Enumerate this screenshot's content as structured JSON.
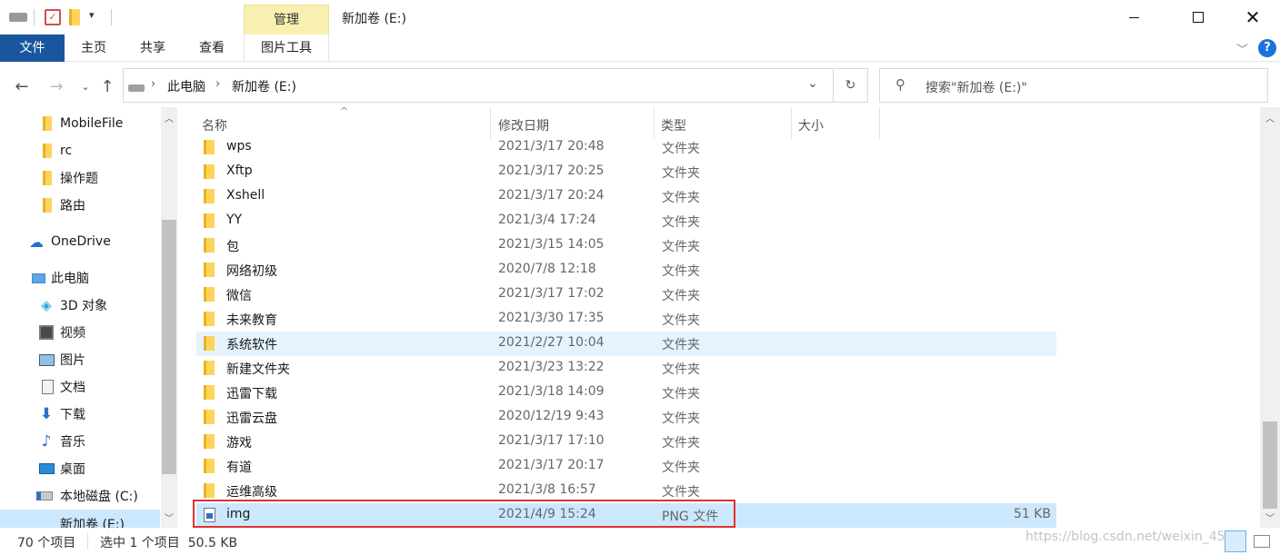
{
  "window": {
    "title": "新加卷 (E:)",
    "manage_tab": "管理",
    "minimize_icon": "minimize-icon",
    "maximize_icon": "maximize-icon",
    "close_icon": "close-icon"
  },
  "ribbon": {
    "tabs": {
      "file": "文件",
      "home": "主页",
      "share": "共享",
      "view": "查看",
      "picture_tools": "图片工具"
    },
    "help_icon": "?"
  },
  "address": {
    "crumb_1": "此电脑",
    "crumb_2": "新加卷 (E:)",
    "search_placeholder": "搜索\"新加卷 (E:)\""
  },
  "nav": {
    "items": [
      {
        "label": "MobileFile",
        "icon": "folder-icon"
      },
      {
        "label": "rc",
        "icon": "folder-icon"
      },
      {
        "label": "操作题",
        "icon": "folder-icon"
      },
      {
        "label": "路由",
        "icon": "folder-icon"
      },
      {
        "label": "OneDrive",
        "icon": "cloud-icon"
      },
      {
        "label": "此电脑",
        "icon": "computer-icon"
      },
      {
        "label": "3D 对象",
        "icon": "cube-icon"
      },
      {
        "label": "视频",
        "icon": "video-icon"
      },
      {
        "label": "图片",
        "icon": "picture-icon"
      },
      {
        "label": "文档",
        "icon": "document-icon"
      },
      {
        "label": "下载",
        "icon": "download-icon"
      },
      {
        "label": "音乐",
        "icon": "music-icon"
      },
      {
        "label": "桌面",
        "icon": "desktop-icon"
      },
      {
        "label": "本地磁盘 (C:)",
        "icon": "drive-icon"
      },
      {
        "label": "新加卷 (E:)",
        "icon": "drive-icon"
      }
    ]
  },
  "columns": {
    "name": "名称",
    "modified": "修改日期",
    "type": "类型",
    "size": "大小"
  },
  "files": [
    {
      "name": "wps",
      "date": "2021/3/17 20:48",
      "type": "文件夹",
      "size": ""
    },
    {
      "name": "Xftp",
      "date": "2021/3/17 20:25",
      "type": "文件夹",
      "size": ""
    },
    {
      "name": "Xshell",
      "date": "2021/3/17 20:24",
      "type": "文件夹",
      "size": ""
    },
    {
      "name": "YY",
      "date": "2021/3/4 17:24",
      "type": "文件夹",
      "size": ""
    },
    {
      "name": "包",
      "date": "2021/3/15 14:05",
      "type": "文件夹",
      "size": ""
    },
    {
      "name": "网络初级",
      "date": "2020/7/8 12:18",
      "type": "文件夹",
      "size": ""
    },
    {
      "name": "微信",
      "date": "2021/3/17 17:02",
      "type": "文件夹",
      "size": ""
    },
    {
      "name": "未来教育",
      "date": "2021/3/30 17:35",
      "type": "文件夹",
      "size": ""
    },
    {
      "name": "系统软件",
      "date": "2021/2/27 10:04",
      "type": "文件夹",
      "size": ""
    },
    {
      "name": "新建文件夹",
      "date": "2021/3/23 13:22",
      "type": "文件夹",
      "size": ""
    },
    {
      "name": "迅雷下载",
      "date": "2021/3/18 14:09",
      "type": "文件夹",
      "size": ""
    },
    {
      "name": "迅雷云盘",
      "date": "2020/12/19 9:43",
      "type": "文件夹",
      "size": ""
    },
    {
      "name": "游戏",
      "date": "2021/3/17 17:10",
      "type": "文件夹",
      "size": ""
    },
    {
      "name": "有道",
      "date": "2021/3/17 20:17",
      "type": "文件夹",
      "size": ""
    },
    {
      "name": "运维高级",
      "date": "2021/3/8 16:57",
      "type": "文件夹",
      "size": ""
    },
    {
      "name": "img",
      "date": "2021/4/9 15:24",
      "type": "PNG 文件",
      "size": "51 KB"
    }
  ],
  "status": {
    "count": "70 个项目",
    "selection": "选中 1 个项目  50.5 KB"
  },
  "watermark": "https://blog.csdn.net/weixin_45"
}
